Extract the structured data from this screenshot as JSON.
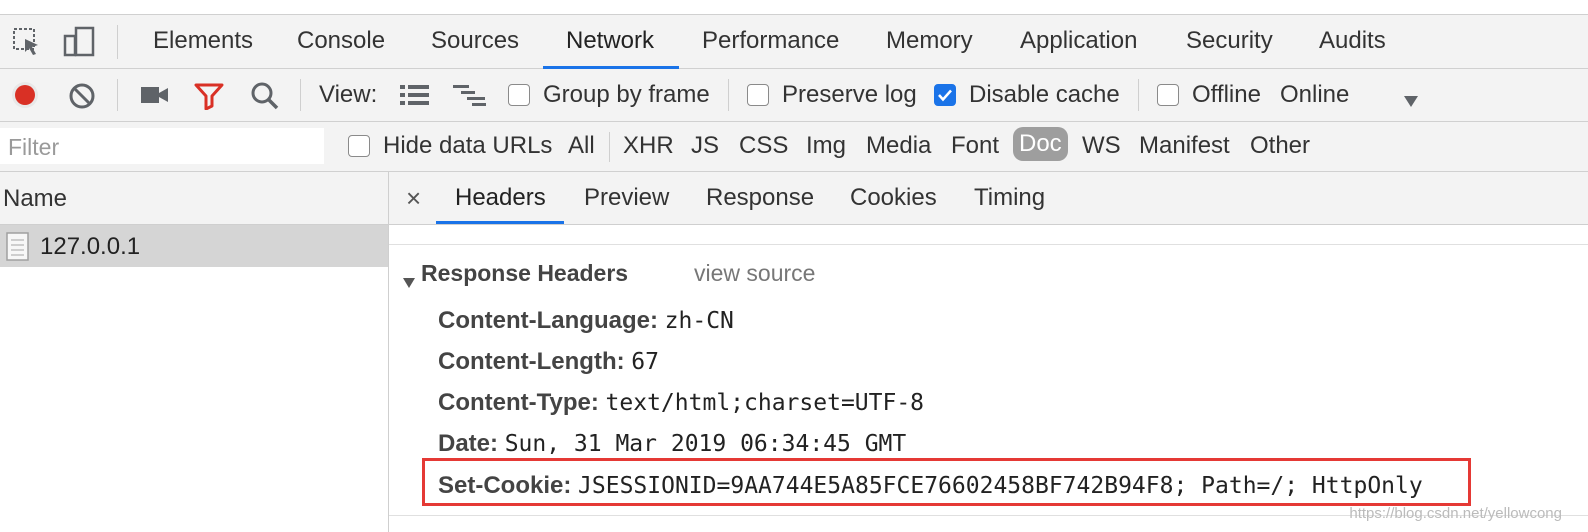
{
  "devtools": {
    "main_tabs": [
      "Elements",
      "Console",
      "Sources",
      "Network",
      "Performance",
      "Memory",
      "Application",
      "Security",
      "Audits"
    ],
    "active_tab": "Network"
  },
  "toolbar": {
    "view_label": "View:",
    "group_by_frame": {
      "label": "Group by frame",
      "checked": false
    },
    "preserve_log": {
      "label": "Preserve log",
      "checked": false
    },
    "disable_cache": {
      "label": "Disable cache",
      "checked": true
    },
    "offline": {
      "label": "Offline",
      "checked": false
    },
    "throttling": "Online",
    "colors": {
      "record": "#d93025",
      "filter": "#d93025",
      "accent": "#1a73e8"
    }
  },
  "filterbar": {
    "placeholder": "Filter",
    "hide_data_urls": "Hide data URLs",
    "types": [
      "All",
      "XHR",
      "JS",
      "CSS",
      "Img",
      "Media",
      "Font",
      "Doc",
      "WS",
      "Manifest",
      "Other"
    ],
    "active_type": "Doc"
  },
  "requests": {
    "column_name": "Name",
    "items": [
      {
        "name": "127.0.0.1"
      }
    ]
  },
  "detail": {
    "close": "×",
    "tabs": [
      "Headers",
      "Preview",
      "Response",
      "Cookies",
      "Timing"
    ],
    "active_tab": "Headers",
    "section_title": "Response Headers",
    "view_source": "view source",
    "headers": [
      {
        "key": "Content-Language:",
        "value": "zh-CN"
      },
      {
        "key": "Content-Length:",
        "value": "67"
      },
      {
        "key": "Content-Type:",
        "value": "text/html;charset=UTF-8"
      },
      {
        "key": "Date:",
        "value": "Sun, 31 Mar 2019 06:34:45 GMT"
      },
      {
        "key": "Set-Cookie:",
        "value": "JSESSIONID=9AA744E5A85FCE76602458BF742B94F8; Path=/; HttpOnly"
      }
    ],
    "highlight_color": "#e53935"
  },
  "watermark": "https://blog.csdn.net/yellowcong"
}
